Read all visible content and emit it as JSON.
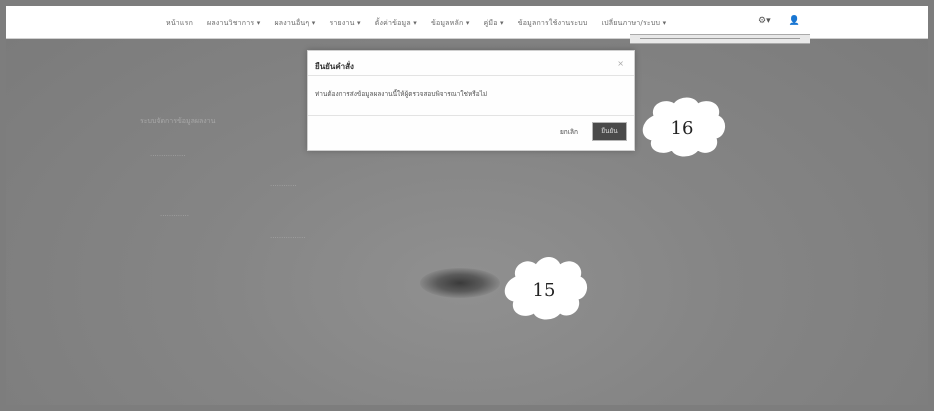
{
  "nav": {
    "items": [
      "หน้าแรก",
      "ผลงานวิชาการ ▾",
      "ผลงานอื่นๆ ▾",
      "รายงาน ▾",
      "ตั้งค่าข้อมูล ▾",
      "ข้อมูลหลัก ▾",
      "คู่มือ ▾",
      "ข้อมูลการใช้งานระบบ",
      "เปลี่ยนภาษา/ระบบ ▾"
    ],
    "icons": [
      "gear-icon",
      "user-icon"
    ],
    "icon_glyphs": [
      "⚙▾",
      "👤"
    ]
  },
  "background": {
    "page_heading": "ระบบจัดการข้อมูลผลงาน",
    "faded_lines": [
      "................",
      "............",
      ".............",
      "................"
    ]
  },
  "dialog": {
    "title": "ยืนยันคำสั่ง",
    "close": "×",
    "message": "ท่านต้องการส่งข้อมูลผลงานนี้ให้ผู้ตรวจสอบพิจารณาใช่หรือไม่",
    "cancel_label": "ยกเลิก",
    "ok_label": "ยืนยัน"
  },
  "callouts": [
    {
      "number": "16"
    },
    {
      "number": "15"
    }
  ],
  "colors": {
    "overlay": "#808080",
    "dialog_bg": "#fefefe",
    "ok_button": "#4a4a4a"
  }
}
